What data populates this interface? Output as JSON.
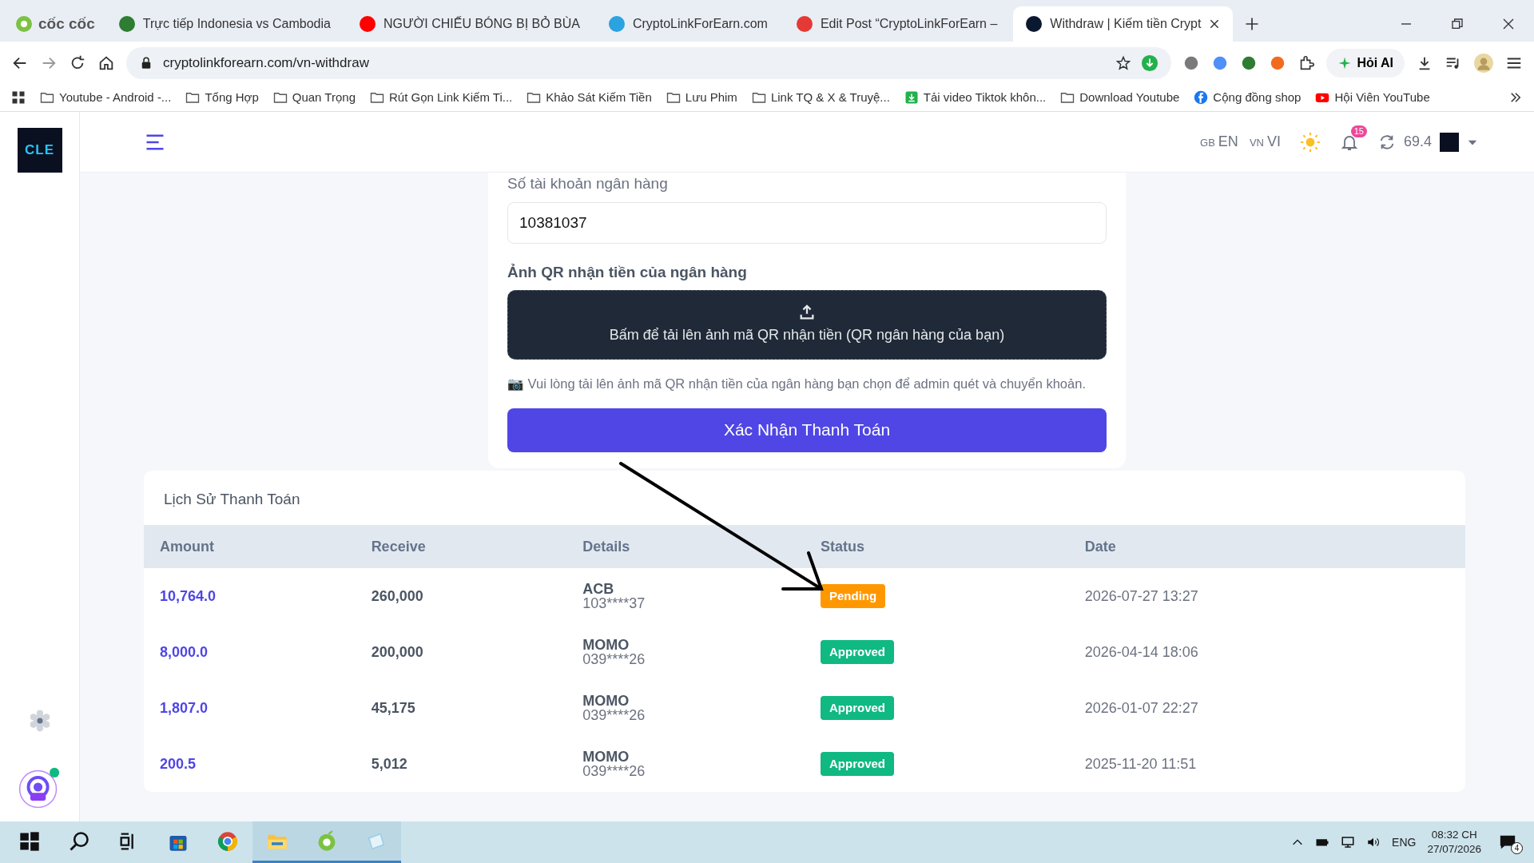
{
  "browser": {
    "name": "cốc cốc",
    "tabs": [
      {
        "title": "Trực tiếp Indonesia vs Cambodia",
        "kind": "sports",
        "selected": false
      },
      {
        "title": "NGƯỜI CHIẾU BÓNG BỊ BỎ BÙA",
        "kind": "video",
        "selected": false
      },
      {
        "title": "CryptoLinkForEarn.com",
        "kind": "chat",
        "selected": false
      },
      {
        "title": "Edit Post “CryptoLinkForEarn –",
        "kind": "editor",
        "selected": false
      },
      {
        "title": "Withdraw | Kiếm tiền Crypt",
        "kind": "site",
        "selected": true
      }
    ],
    "address": "cryptolinkforearn.com/vn-withdraw",
    "ai_button": "Hỏi AI",
    "bookmarks": [
      {
        "label": "Youtube - Android -...",
        "kind": "folder"
      },
      {
        "label": "Tổng Hợp",
        "kind": "folder"
      },
      {
        "label": "Quan Trọng",
        "kind": "folder"
      },
      {
        "label": "Rút Gọn Link Kiếm Ti...",
        "kind": "folder"
      },
      {
        "label": "Khảo Sát Kiếm Tiền",
        "kind": "folder"
      },
      {
        "label": "Lưu Phim",
        "kind": "folder"
      },
      {
        "label": "Link TQ & X & Truyệ...",
        "kind": "folder"
      },
      {
        "label": "Tải video Tiktok khôn...",
        "kind": "download"
      },
      {
        "label": "Download Youtube",
        "kind": "folder"
      },
      {
        "label": "Cộng đồng shop",
        "kind": "facebook"
      },
      {
        "label": "Hội Viên YouTube",
        "kind": "youtube"
      }
    ]
  },
  "app": {
    "logo": "CLE",
    "languages": [
      {
        "flag": "GB",
        "code": "EN"
      },
      {
        "flag": "VN",
        "code": "VI"
      }
    ],
    "notification_count": "15",
    "balance": "69.4",
    "form": {
      "account_label": "Số tài khoản ngân hàng",
      "account_value": "10381037",
      "qr_label": "Ảnh QR nhận tiền của ngân hàng",
      "upload_text": "Bấm để tải lên ảnh mã QR nhận tiền (QR ngân hàng của bạn)",
      "note": "📷 Vui lòng tải lên ảnh mã QR nhận tiền của ngân hàng bạn chọn để admin quét và chuyển khoản.",
      "submit": "Xác Nhận Thanh Toán"
    },
    "history": {
      "title": "Lịch Sử Thanh Toán",
      "columns": [
        "Amount",
        "Receive",
        "Details",
        "Status",
        "Date"
      ],
      "rows": [
        {
          "amount": "10,764.0",
          "receive": "260,000",
          "method": "ACB",
          "account": "103****37",
          "status": "Pending",
          "kind": "pending",
          "date": "2026-07-27 13:27"
        },
        {
          "amount": "8,000.0",
          "receive": "200,000",
          "method": "MOMO",
          "account": "039****26",
          "status": "Approved",
          "kind": "approved",
          "date": "2026-04-14 18:06"
        },
        {
          "amount": "1,807.0",
          "receive": "45,175",
          "method": "MOMO",
          "account": "039****26",
          "status": "Approved",
          "kind": "approved",
          "date": "2026-01-07 22:27"
        },
        {
          "amount": "200.5",
          "receive": "5,012",
          "method": "MOMO",
          "account": "039****26",
          "status": "Approved",
          "kind": "approved",
          "date": "2025-11-20 11:51"
        }
      ]
    }
  },
  "taskbar": {
    "apps": [
      {
        "kind": "start",
        "running": false
      },
      {
        "kind": "search",
        "running": false
      },
      {
        "kind": "taskview",
        "running": false
      },
      {
        "kind": "store",
        "running": false
      },
      {
        "kind": "chrome",
        "running": false
      },
      {
        "kind": "files",
        "running": true
      },
      {
        "kind": "coccoc",
        "running": true
      },
      {
        "kind": "notes",
        "running": true
      }
    ],
    "language": "ENG",
    "time": "08:32 CH",
    "date": "27/07/2026",
    "notifications": "4"
  }
}
